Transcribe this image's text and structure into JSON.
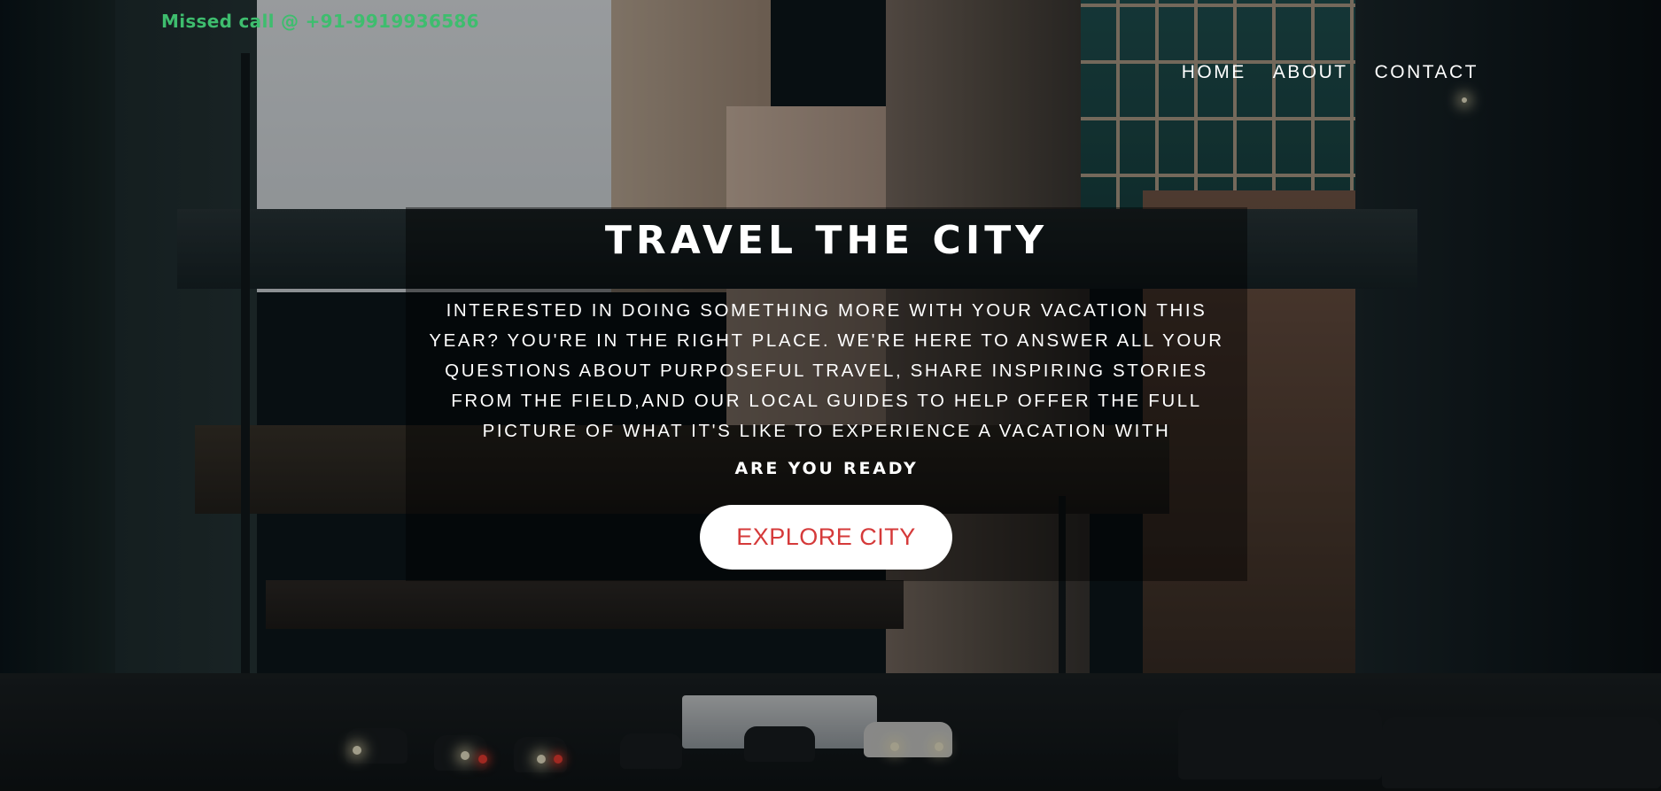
{
  "header": {
    "missed_call": "Missed call @ +91-9919936586"
  },
  "nav": {
    "items": [
      {
        "label": "HOME"
      },
      {
        "label": "ABOUT"
      },
      {
        "label": "CONTACT"
      }
    ]
  },
  "hero": {
    "title": "TRAVEL THE CITY",
    "text": "INTERESTED IN DOING SOMETHING MORE WITH YOUR VACATION THIS YEAR? YOU'RE IN THE RIGHT PLACE. WE'RE HERE TO ANSWER ALL YOUR QUESTIONS ABOUT PURPOSEFUL TRAVEL, SHARE INSPIRING STORIES FROM THE FIELD,AND OUR LOCAL GUIDES TO HELP OFFER THE FULL PICTURE OF WHAT IT'S LIKE TO EXPERIENCE A VACATION WITH",
    "subheading": "ARE YOU READY",
    "cta_label": "EXPLORE CITY"
  },
  "colors": {
    "missed_call_text": "#3ebd6e",
    "cta_text": "#d53a3a",
    "cta_background": "#ffffff",
    "nav_text": "#ffffff"
  }
}
